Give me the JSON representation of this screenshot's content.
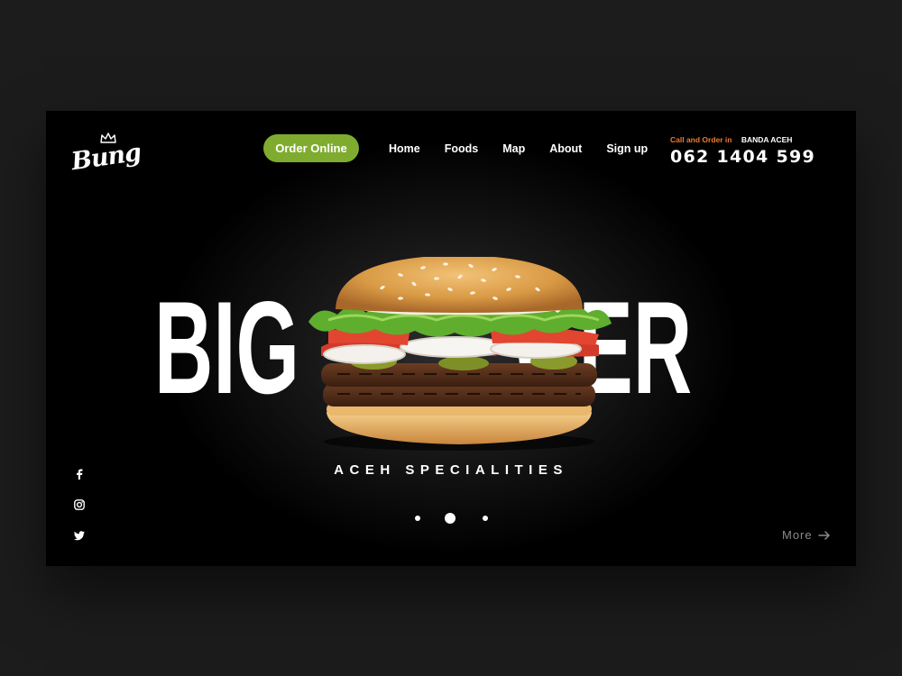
{
  "brand": {
    "logo_text": "Bung",
    "logo_icon": "crown-icon"
  },
  "cta": {
    "label": "Order Online",
    "color": "#7fac2e"
  },
  "nav": {
    "items": [
      "Home",
      "Foods",
      "Map",
      "About",
      "Sign up"
    ]
  },
  "contact": {
    "label": "Call and Order in",
    "city": "BANDA ACEH",
    "phone": "062 1404 599",
    "label_color": "#ef7a2e"
  },
  "hero": {
    "headline_left": "BIG",
    "headline_right": "GER",
    "tagline": "ACEH SPECIALITIES",
    "image": "burger-image"
  },
  "carousel": {
    "count": 3,
    "active_index": 1
  },
  "social": [
    "facebook-icon",
    "instagram-icon",
    "twitter-icon"
  ],
  "more": {
    "label": "More",
    "icon": "arrow-right-icon"
  }
}
